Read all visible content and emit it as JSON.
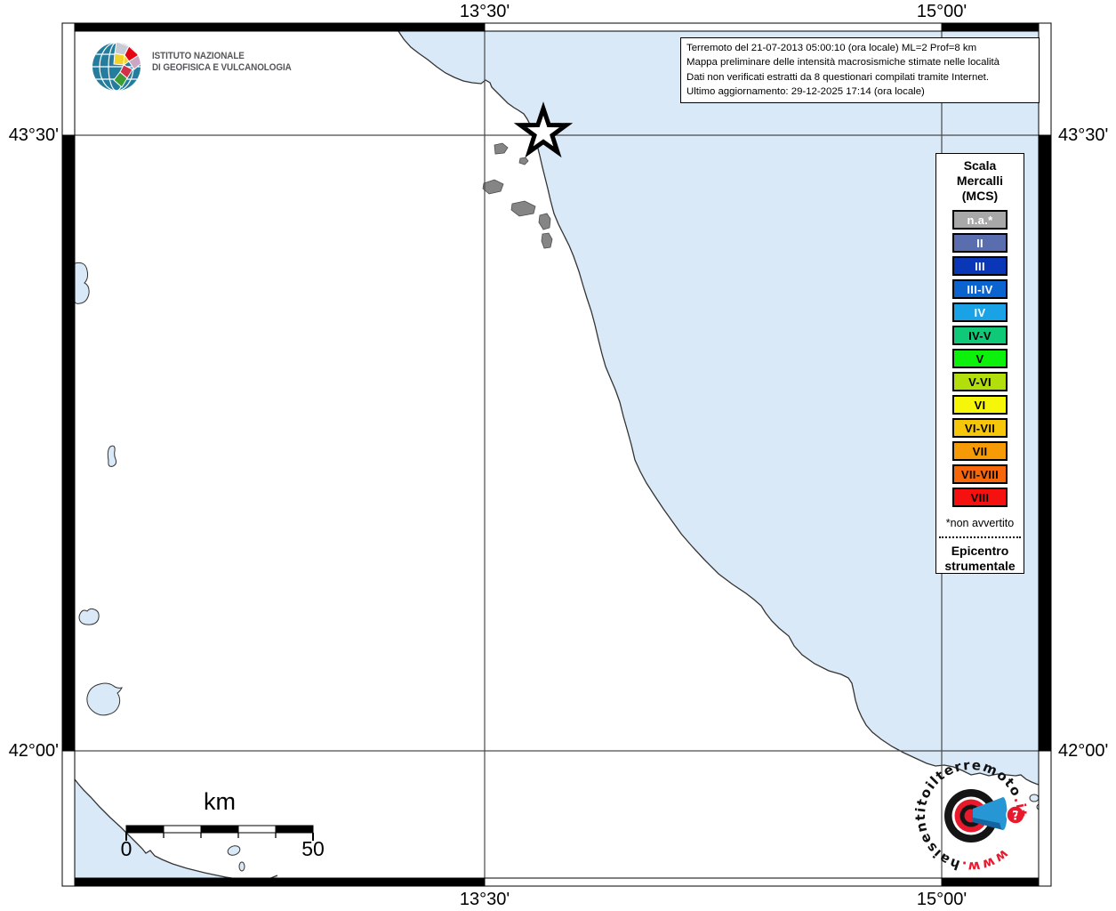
{
  "axis": {
    "top_left": "13°30'",
    "top_right": "15°00'",
    "bottom_left": "13°30'",
    "bottom_right": "15°00'",
    "left_top": "43°30'",
    "left_bottom": "42°00'",
    "right_top": "43°30'",
    "right_bottom": "42°00'"
  },
  "info_box": {
    "line1": "Terremoto del 21-07-2013 05:00:10 (ora locale) ML=2 Prof=8 km",
    "line2": "Mappa preliminare delle intensità macrosismiche stimate nelle località",
    "line3": "Dati non verificati estratti da 8 questionari compilati tramite Internet.",
    "line4": "Ultimo aggiornamento: 29-12-2025 17:14 (ora locale)"
  },
  "legend": {
    "title_line1": "Scala",
    "title_line2": "Mercalli",
    "title_line3": "(MCS)",
    "items": [
      {
        "label": "n.a.*",
        "color": "#a8a8a8",
        "text": "#ffffff"
      },
      {
        "label": "II",
        "color": "#5a6dae",
        "text": "#ffffff"
      },
      {
        "label": "III",
        "color": "#0a36b8",
        "text": "#ffffff"
      },
      {
        "label": "III-IV",
        "color": "#0b63cf",
        "text": "#ffffff"
      },
      {
        "label": "IV",
        "color": "#19a2e5",
        "text": "#ffffff"
      },
      {
        "label": "IV-V",
        "color": "#0fc878",
        "text": "#000000"
      },
      {
        "label": "V",
        "color": "#0cf00c",
        "text": "#000000"
      },
      {
        "label": "V-VI",
        "color": "#b2df0b",
        "text": "#000000"
      },
      {
        "label": "VI",
        "color": "#f6f60b",
        "text": "#000000"
      },
      {
        "label": "VI-VII",
        "color": "#f6c60a",
        "text": "#000000"
      },
      {
        "label": "VII",
        "color": "#f69a05",
        "text": "#000000"
      },
      {
        "label": "VII-VIII",
        "color": "#f6660a",
        "text": "#000000"
      },
      {
        "label": "VIII",
        "color": "#f61111",
        "text": "#000000"
      }
    ],
    "footnote": "*non avvertito",
    "epicenter_line1": "Epicentro",
    "epicenter_line2": "strumentale"
  },
  "ingv": {
    "name_line1": "ISTITUTO NAZIONALE",
    "name_line2": "DI GEOFISICA E VULCANOLOGIA"
  },
  "scale_bar": {
    "unit": "km",
    "start": "0",
    "end": "50"
  },
  "website_logo": {
    "part_www": "www.",
    "part_name": "haisentitoilterremoto",
    "part_it": ".it",
    "question_mark": "?"
  },
  "colors": {
    "sea": "#d9e9f7",
    "land": "#ffffff",
    "grid": "#4a4a4a",
    "coast": "#333333",
    "logo_red": "#e8192c",
    "logo_blue": "#2796d4"
  }
}
